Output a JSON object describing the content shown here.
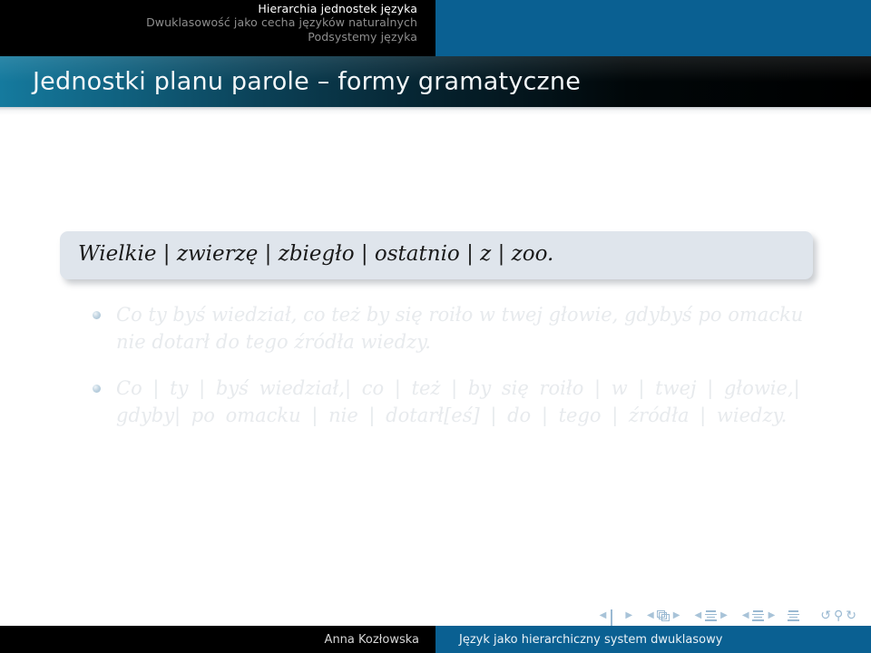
{
  "header": {
    "lines": [
      {
        "text": "Hierarchia jednostek języka",
        "state": "active"
      },
      {
        "text": "Dwuklasowość jako cecha języków naturalnych",
        "state": "dim"
      },
      {
        "text": "Podsystemy języka",
        "state": "dim"
      }
    ],
    "accent_color": "#0a6092",
    "background_color": "#000000"
  },
  "title": {
    "text": "Jednostki planu parole – formy gramatyczne"
  },
  "content": {
    "example_box": {
      "text": "Wielkie | zwierzę | zbiegło | ostatnio | z | zoo."
    },
    "bullets": [
      {
        "text": "Co ty byś wiedział, co też by się roiło w twej głowie, gdybyś po omacku nie dotarł do tego źródła wiedzy.",
        "spaced": false
      },
      {
        "text": "Co | ty | byś wiedział,| co | też | by się roiło | w | twej | głowie,| gdyby| po omacku | nie | dotarł[eś] | do | tego | źródła | wiedzy.",
        "spaced": true
      }
    ]
  },
  "navigation": {
    "groups": [
      {
        "name": "slide",
        "icon": "square-icon",
        "prev": "◀",
        "next": "▶"
      },
      {
        "name": "frame",
        "icon": "frames-stack-icon",
        "prev": "◀",
        "next": "▶"
      },
      {
        "name": "subsection",
        "icon": "lines-icon",
        "prev": "◀",
        "next": "▶"
      },
      {
        "name": "section",
        "icon": "lines-icon",
        "prev": "◀",
        "next": "▶"
      }
    ],
    "document_icon": "lines-icon",
    "back_icon": "↺",
    "search_icon": "⚲",
    "forward_icon": "↻"
  },
  "footer": {
    "author": "Anna Kozłowska",
    "subject": "Język jako hierarchiczny system dwuklasowy"
  }
}
